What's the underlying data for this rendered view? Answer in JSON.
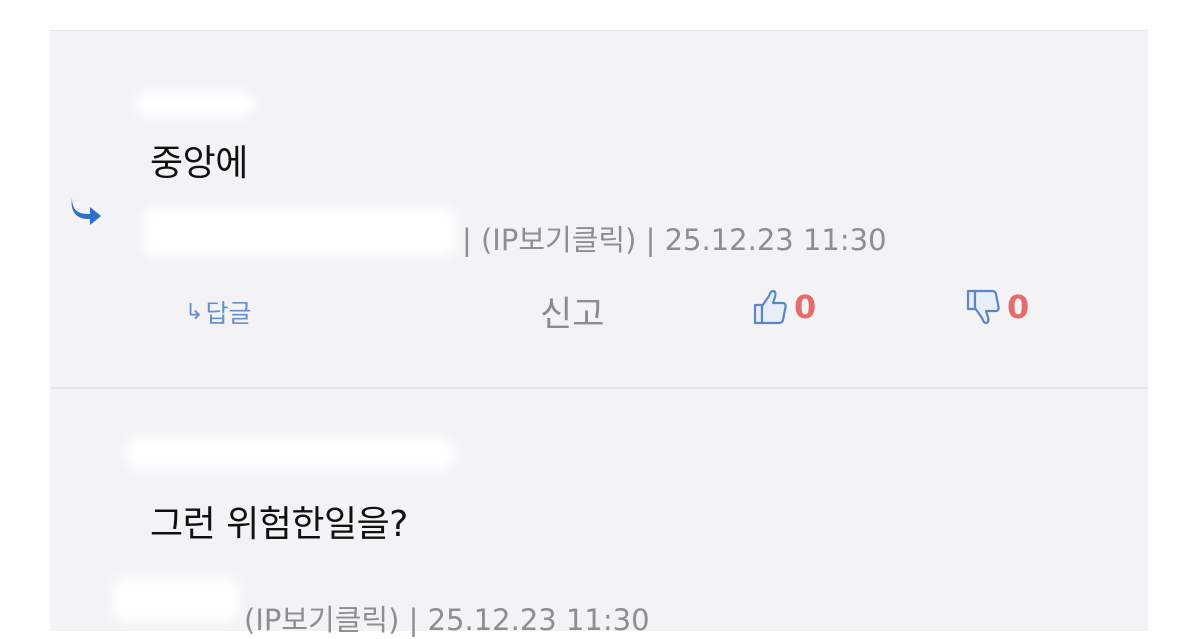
{
  "comments": [
    {
      "text": "중앙에",
      "meta": "| (IP보기클릭) | 25.12.23 11:30",
      "is_reply": true,
      "actions": {
        "reply_label": "답글",
        "report_label": "신고",
        "like_count": "0",
        "dislike_count": "0"
      }
    },
    {
      "text": "그런 위험한일을?",
      "meta": "(IP보기클릭) | 25.12.23 11:30"
    }
  ],
  "colors": {
    "panel_bg": "#f3f3f6",
    "reply_blue": "#6a8fc6",
    "vote_red": "#e56c6c",
    "meta_gray": "#8d8d92"
  },
  "icons": [
    "reply-arrow-icon",
    "reply-small-arrow-icon",
    "thumbs-up-icon",
    "thumbs-down-icon"
  ]
}
